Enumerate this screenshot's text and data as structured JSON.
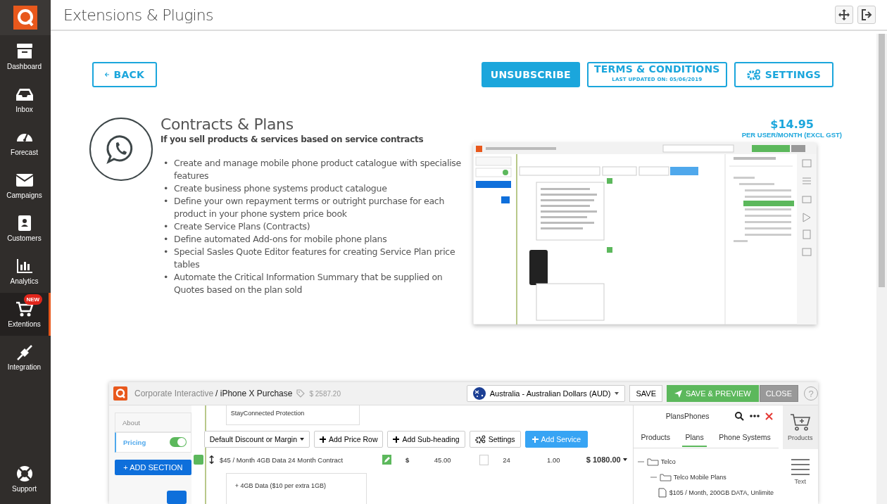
{
  "header": {
    "title": "Extensions & Plugins"
  },
  "sidebar": {
    "items": [
      {
        "label": "Dashboard",
        "selected": false
      },
      {
        "label": "Inbox",
        "selected": false
      },
      {
        "label": "Forecast",
        "selected": false
      },
      {
        "label": "Campaigns",
        "selected": false
      },
      {
        "label": "Customers",
        "selected": false
      },
      {
        "label": "Analytics",
        "selected": false
      },
      {
        "label": "Extentions",
        "selected": true,
        "badge": "NEW"
      },
      {
        "label": "Integration",
        "selected": false
      }
    ],
    "footer": {
      "label": "Support"
    }
  },
  "actions": {
    "back": "BACK",
    "unsubscribe": "UNSUBSCRIBE",
    "terms": "TERMS & CONDITIONS",
    "terms_note": "LAST UPDATED ON: 05/06/2019",
    "settings": "SETTINGS"
  },
  "plugin": {
    "title": "Contracts & Plans",
    "subtitle": "If you sell products & services based on service contracts",
    "features": [
      {
        "bullet": "•",
        "text": "Create and manage mobile phone product catalogue with specialise features"
      },
      {
        "bullet": "•",
        "text": "Create business phone systems product catalogue"
      },
      {
        "bullet": "•",
        "text": "Define your own repayment terms or outright purchase for each product in your phone system price book"
      },
      {
        "bullet": "•",
        "text": "Create Service Plans (Contracts)"
      },
      {
        "bullet": "•",
        "text": "Define automated Add-ons for mobile phone plans"
      },
      {
        "bullet": "•",
        "text": "Special Sasles Quote Editor features for creating Service Plan price tables"
      },
      {
        "bullet": "•",
        "text": "Automate the Critical Information Summary that be supplied on Quotes based on the plan sold"
      }
    ],
    "price": "$14.95",
    "price_note": "PER USER/MONTH (EXCL GST)"
  },
  "screenshot": {
    "company": "Corporate Interactive",
    "quote": "/ iPhone X Purchase",
    "total": "$ 2587.20",
    "currency": "Australia - Australian Dollars (AUD)",
    "buttons": [
      {
        "label": "SAVE",
        "kind": "plain"
      },
      {
        "label": "SAVE & PREVIEW",
        "kind": "primary"
      },
      {
        "label": "CLOSE",
        "kind": "muted"
      }
    ],
    "help": "?",
    "sections": [
      {
        "label": "About",
        "kind": "plain"
      },
      {
        "label": "Pricing",
        "kind": "toggle",
        "on": true
      }
    ],
    "add_section": "+ ADD SECTION",
    "heading_row": "StayConnected Protection",
    "toolbar": [
      {
        "label": "Default Discount or Margin",
        "kind": "dropdown"
      },
      {
        "label": "Add Price Row",
        "kind": "add"
      },
      {
        "label": "Add Sub-heading",
        "kind": "add"
      },
      {
        "label": "Settings",
        "kind": "settings"
      },
      {
        "label": "Add Service",
        "kind": "primary"
      }
    ],
    "line": {
      "name": "$45 / Month 4GB Data 24 Month Contract",
      "currency": "$",
      "price": "45.00",
      "term": "24",
      "qty": "1.00",
      "total": "$ 1080.00",
      "checked": false
    },
    "line_details": [
      "+ 4GB Data ($10 per extra 1GB)"
    ],
    "panel": {
      "title": "PlansPhones",
      "tabs": [
        {
          "label": "Products",
          "selected": false
        },
        {
          "label": "Plans",
          "selected": true
        },
        {
          "label": "Phone Systems",
          "selected": false
        }
      ],
      "tree": [
        {
          "label": "Telco",
          "children": [
            {
              "label": "Telco Mobile Plans",
              "children": [
                {
                  "label": "$105 / Month, 200GB DATA, Unlimite"
                }
              ]
            }
          ]
        }
      ]
    },
    "tools": [
      {
        "label": "Products",
        "selected": true
      },
      {
        "label": "Text",
        "selected": false
      }
    ]
  }
}
